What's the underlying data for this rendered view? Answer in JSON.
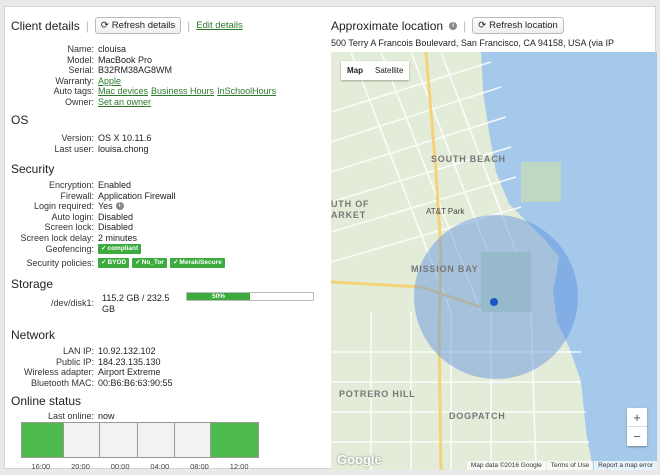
{
  "client": {
    "title": "Client details",
    "refresh_label": "Refresh details",
    "edit_label": "Edit details",
    "fields": [
      {
        "key": "Name:",
        "value": "clouisa"
      },
      {
        "key": "Model:",
        "value": "MacBook Pro"
      },
      {
        "key": "Serial:",
        "value": "B32RM38AG8WM"
      },
      {
        "key": "Warranty:",
        "value": "Apple",
        "link": true
      },
      {
        "key": "Auto tags:",
        "tags": [
          "Mac devices",
          "Business Hours",
          "InSchoolHours"
        ]
      },
      {
        "key": "Owner:",
        "value": "Set an owner",
        "link": true
      }
    ]
  },
  "os": {
    "title": "OS",
    "fields": [
      {
        "key": "Version:",
        "value": "OS X 10.11.6"
      },
      {
        "key": "Last user:",
        "value": "louisa.chong"
      }
    ]
  },
  "security": {
    "title": "Security",
    "fields": [
      {
        "key": "Encryption:",
        "value": "Enabled"
      },
      {
        "key": "Firewall:",
        "value": "Application Firewall"
      },
      {
        "key": "Login required:",
        "value": "Yes"
      },
      {
        "key": "Auto login:",
        "value": "Disabled"
      },
      {
        "key": "Screen lock:",
        "value": "Disabled"
      },
      {
        "key": "Screen lock delay:",
        "value": "2 minutes"
      }
    ],
    "geofencing_label": "Geofencing:",
    "geofencing_badge": "compliant",
    "policies_label": "Security policies:",
    "policies": [
      "BYOD",
      "No_Tor",
      "MerakiSecure"
    ]
  },
  "storage": {
    "title": "Storage",
    "disk_label": "/dev/disk1:",
    "usage_line1": "115.2 GB / 232.5",
    "usage_line2": "GB",
    "percent_label": "50%",
    "percent": 50
  },
  "network": {
    "title": "Network",
    "fields": [
      {
        "key": "LAN IP:",
        "value": "10.92.132.102"
      },
      {
        "key": "Public IP:",
        "value": "184.23.135.130"
      },
      {
        "key": "Wireless adapter:",
        "value": "Airport Extreme"
      },
      {
        "key": "Bluetooth MAC:",
        "value": "00:B6:B6:63:90:55"
      }
    ]
  },
  "online": {
    "title": "Online status",
    "last_label": "Last online:",
    "last_value": "now",
    "segments": [
      {
        "state": "online",
        "fraction": 0.18
      },
      {
        "state": "offline",
        "fraction": 0.15
      },
      {
        "state": "offline",
        "fraction": 0.16
      },
      {
        "state": "offline",
        "fraction": 0.16
      },
      {
        "state": "offline",
        "fraction": 0.15
      },
      {
        "state": "online",
        "fraction": 0.2
      }
    ],
    "ticks": [
      "16:00",
      "20:00",
      "00:00",
      "04:00",
      "08:00",
      "12:00"
    ],
    "colors": {
      "online": "#4cbb4c",
      "offline": "#f2f2f2"
    }
  },
  "location": {
    "title": "Approximate location",
    "refresh_label": "Refresh location",
    "address": "500 Terry A Francois Boulevard, San Francisco, CA 94158, USA (via IP",
    "map_tab": "Map",
    "satellite_tab": "Satellite",
    "google": "Google",
    "footer": [
      "Map data ©2016 Google",
      "Terms of Use",
      "Report a map error"
    ],
    "labels": [
      "SOUTH BEACH",
      "AT&T Park",
      "MISSION BAY",
      "POTRERO HILL",
      "DOGPATCH",
      "UTH OF",
      "ARKET"
    ],
    "zoom_in": "+",
    "zoom_out": "−"
  },
  "accent": "#3caa3c"
}
